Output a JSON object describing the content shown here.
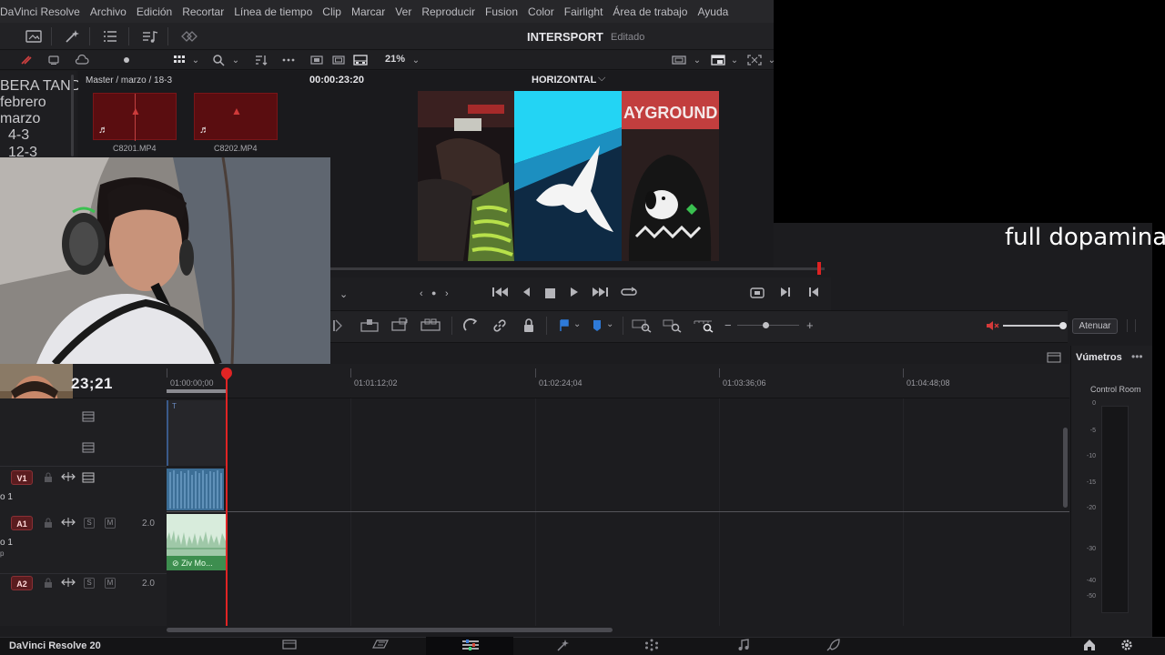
{
  "menu": [
    "DaVinci Resolve",
    "Archivo",
    "Edición",
    "Recortar",
    "Línea de tiempo",
    "Clip",
    "Marcar",
    "Ver",
    "Reproducir",
    "Fusion",
    "Color",
    "Fairlight",
    "Área de trabajo",
    "Ayuda"
  ],
  "project": {
    "title": "INTERSPORT",
    "status": "Editado"
  },
  "toolbar2": {
    "zoom": "21%"
  },
  "bins": {
    "partial_top": "BERA TANDA",
    "items": [
      "febrero",
      "marzo",
      "4-3",
      "12-3"
    ]
  },
  "media_pool": {
    "path": "Master / marzo / 18-3",
    "clips": [
      {
        "name": "C8201.MP4"
      },
      {
        "name": "C8202.MP4"
      }
    ]
  },
  "viewer": {
    "timecode": "00:00:23:20",
    "name": "HORIZONTAL",
    "chevron": "⌵"
  },
  "edit_toolbar": {
    "mute_label": "Atenuar"
  },
  "timeline": {
    "timecode": "23;21",
    "ruler": [
      "01:00:00;00",
      "01:01:12;02",
      "01:02:24;04",
      "01:03:36;06",
      "01:04:48;08"
    ],
    "tracks": {
      "v1": {
        "badge": "V1",
        "name": "o 1"
      },
      "a1": {
        "badge": "A1",
        "name": "o 1",
        "level": "2.0",
        "sub": "p"
      },
      "a2": {
        "badge": "A2",
        "level": "2.0"
      }
    },
    "audio_clip_label": "Ziv Mo..."
  },
  "meters": {
    "title": "Vúmetros",
    "room": "Control Room",
    "scale": [
      "0",
      "-5",
      "-10",
      "-15",
      "-20",
      "-30",
      "-40",
      "-50"
    ]
  },
  "overlay": {
    "caption": "full dopamina"
  },
  "footer": {
    "app_version": "DaVinci Resolve 20"
  },
  "colors": {
    "playhead": "#e02424",
    "video_clip": "#3c6e96",
    "audio_clip": "#3d8e4f",
    "badge": "#5a1c1f"
  }
}
